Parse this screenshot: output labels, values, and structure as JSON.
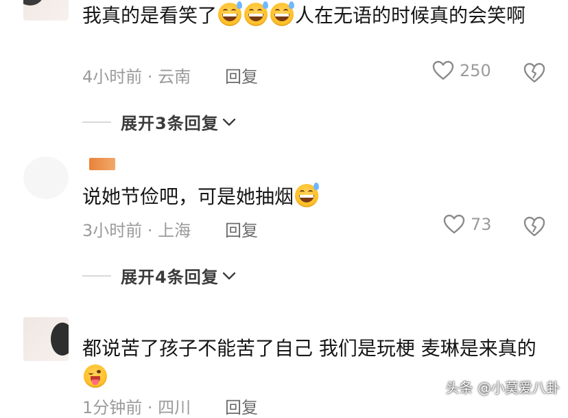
{
  "comments": [
    {
      "username": "",
      "text": "我真的是看笑了",
      "text_after": "人在无语的时候真的会笑啊",
      "emojis": [
        "grin-sweat-emoji",
        "grin-sweat-emoji",
        "grin-sweat-emoji"
      ],
      "meta": "4小时前 · 云南",
      "reply_label": "回复",
      "likes": "250",
      "expand_label": "展开3条回复"
    },
    {
      "username": "",
      "text": "说她节俭吧，可是她抽烟",
      "emojis": [
        "grin-sweat-emoji"
      ],
      "meta": "3小时前 · 上海",
      "reply_label": "回复",
      "likes": "73",
      "expand_label": "展开4条回复"
    },
    {
      "username": "",
      "text": "都说苦了孩子不能苦了自己 我们是玩梗 麦琳是来真的",
      "emojis": [
        "wink-tongue-emoji"
      ],
      "meta": "1分钟前 · 四川",
      "reply_label": "回复"
    }
  ],
  "watermark": "头条 @小莫爱八卦",
  "colors": {
    "text": "#161616",
    "meta": "#9a9a9a",
    "reply": "#6b6b6b",
    "emoji": "#ffc12a"
  }
}
